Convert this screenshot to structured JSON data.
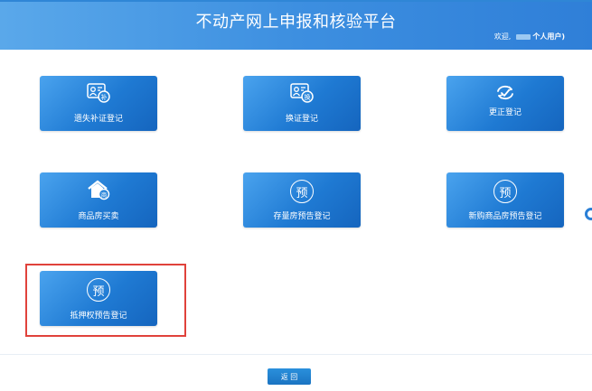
{
  "header": {
    "title": "不动产网上申报和核验平台",
    "welcome_prefix": "欢迎,",
    "welcome_suffix": "个人用户)"
  },
  "tiles": [
    {
      "label": "遗失补证登记",
      "icon": "id-card-replace-icon",
      "icon_glyph": "补"
    },
    {
      "label": "换证登记",
      "icon": "id-card-exchange-icon",
      "icon_glyph": "换"
    },
    {
      "label": "更正登记",
      "icon": "refresh-correction-icon"
    },
    {
      "label": "商品房买卖",
      "icon": "house-commerce-icon",
      "icon_glyph": "商"
    },
    {
      "label": "存量房预告登记",
      "icon": "pre-notice-icon",
      "icon_glyph": "预"
    },
    {
      "label": "新购商品房预告登记",
      "icon": "pre-notice-icon",
      "icon_glyph": "预"
    },
    {
      "label": "抵押权预告登记",
      "icon": "pre-notice-icon",
      "icon_glyph": "预"
    }
  ],
  "footer": {
    "back_label": "返 回"
  },
  "colors": {
    "header_start": "#5aa8ea",
    "header_end": "#2f7fd8",
    "tile_start": "#4aa3ee",
    "tile_end": "#1565be",
    "highlight": "#e0423b"
  }
}
